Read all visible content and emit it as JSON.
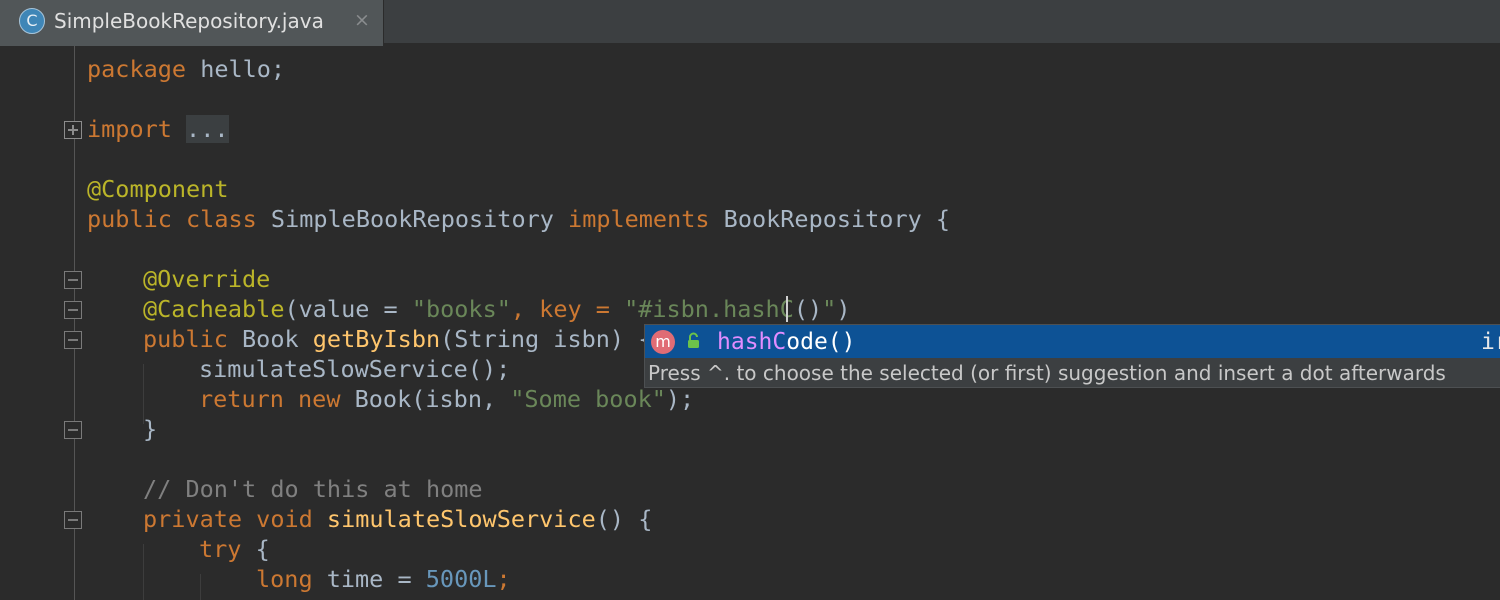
{
  "tab": {
    "icon_letter": "C",
    "title": "SimpleBookRepository.java",
    "close_glyph": "×"
  },
  "code": {
    "l1_kw": "package",
    "l1_rest": " hello;",
    "l3_kw": "import",
    "l3_fold": "...",
    "l5": "@Component",
    "l6_kw1": "public class",
    "l6_name": " SimpleBookRepository ",
    "l6_kw2": "implements",
    "l6_rest": " BookRepository {",
    "l8": "@Override",
    "l9_ann": "@Cacheable",
    "l9_p1": "(value = ",
    "l9_s1": "\"books\"",
    "l9_p2": ", key = ",
    "l9_s2a": "\"#isbn.",
    "l9_hash": "hashC",
    "l9_paren": "()",
    "l9_s2b": "\"",
    "l9_close": ")",
    "l10_kw": "public",
    "l10_p1": " Book ",
    "l10_fn": "getByIsbn",
    "l10_p2": "(String isbn) {",
    "l11": "simulateSlowService();",
    "l12_kw1": "return new",
    "l12_p1": " Book(isbn, ",
    "l12_s": "\"Some book\"",
    "l12_p2": ");",
    "l13": "}",
    "l15": "// Don't do this at home",
    "l16_kw": "private void",
    "l16_fn": " simulateSlowService",
    "l16_p": "() {",
    "l17_kw": "try",
    "l17_p": " {",
    "l18_kw": "long",
    "l18_p": " time = ",
    "l18_num": "5000L",
    "l18_end": ";"
  },
  "completion": {
    "icon_letter": "m",
    "name_match": "hashC",
    "name_rest": "ode()",
    "type_partial": "ir",
    "hint": "Press ^. to choose the selected (or first) suggestion and insert a dot afterwards"
  },
  "colors": {
    "background": "#2b2b2b",
    "keyword": "#cc7832",
    "annotation": "#bbb529",
    "string": "#6a8759",
    "selection": "#0d5295"
  }
}
